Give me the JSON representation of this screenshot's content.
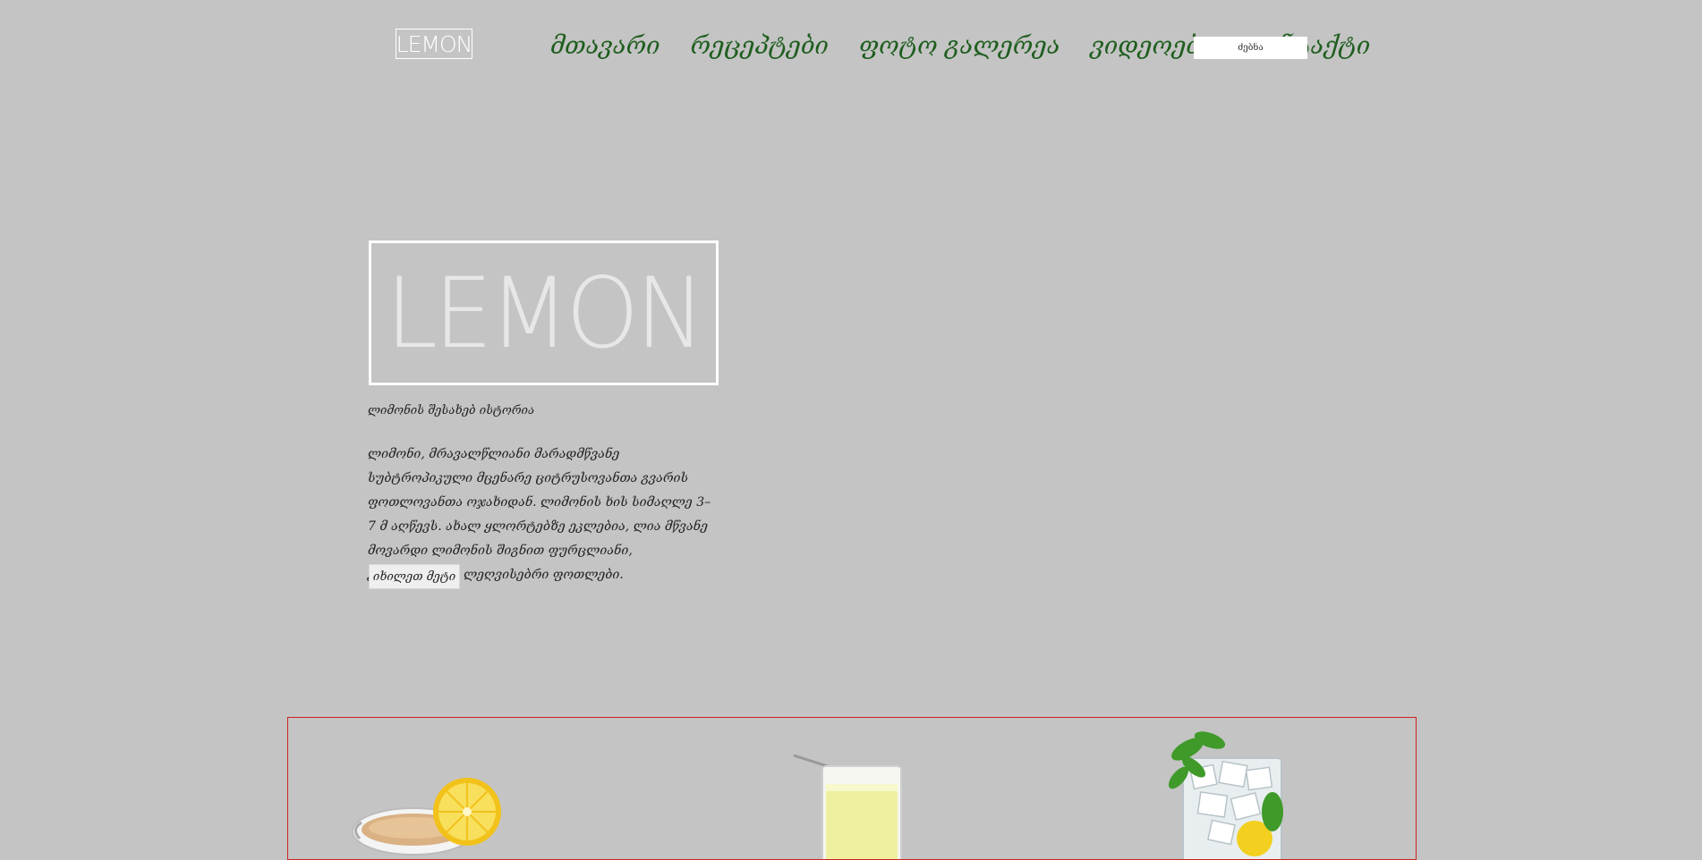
{
  "header": {
    "logo": "LEMON",
    "nav": [
      "მთავარი",
      "რეცეპტები",
      "ფოტო გალერეა",
      "ვიდეოები",
      "კონტაქტი"
    ],
    "search_placeholder": "ძებნა"
  },
  "hero": {
    "logo": "LEMON",
    "subtitle": "ლიმონის შესახებ ისტორია",
    "description": "ლიმონი, მრავალწლიანი მარადმწვანე სუბტროპიკული მცენარე ციტრუსოვანთა გვარის ფოთლოვანთა ოჯახიდან. ლიმონის ხის სიმაღლე 3–7 მ აღწევს. ახალ ყლორტებზე ეკლებია, ლია მწვანე მოვარდი ლიმონის შიგნით ფურცლიანი, კვადრატული, ლეღვისებრი ფოთლები.",
    "button": "იხილეთ მეტი"
  },
  "colors": {
    "background": "#c4c4c4",
    "nav_text": "#1f5e1f",
    "products_border": "#cc2222"
  }
}
